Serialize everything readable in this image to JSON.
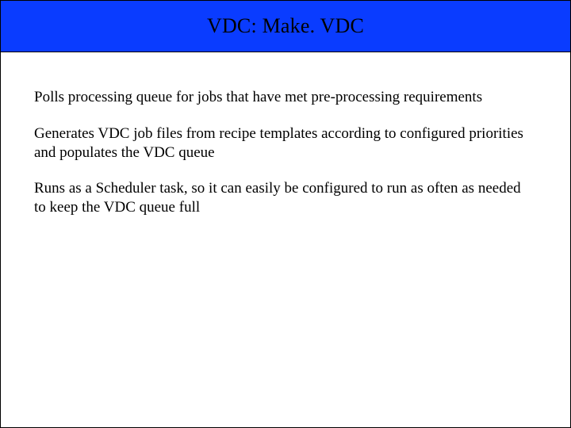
{
  "title": "VDC: Make. VDC",
  "paragraphs": [
    "Polls processing queue for jobs that have met pre-processing requirements",
    "Generates VDC job files from recipe templates according to configured priorities and populates the VDC queue",
    "Runs as a Scheduler task, so it can easily be configured to run as often as needed to keep the VDC queue full"
  ]
}
